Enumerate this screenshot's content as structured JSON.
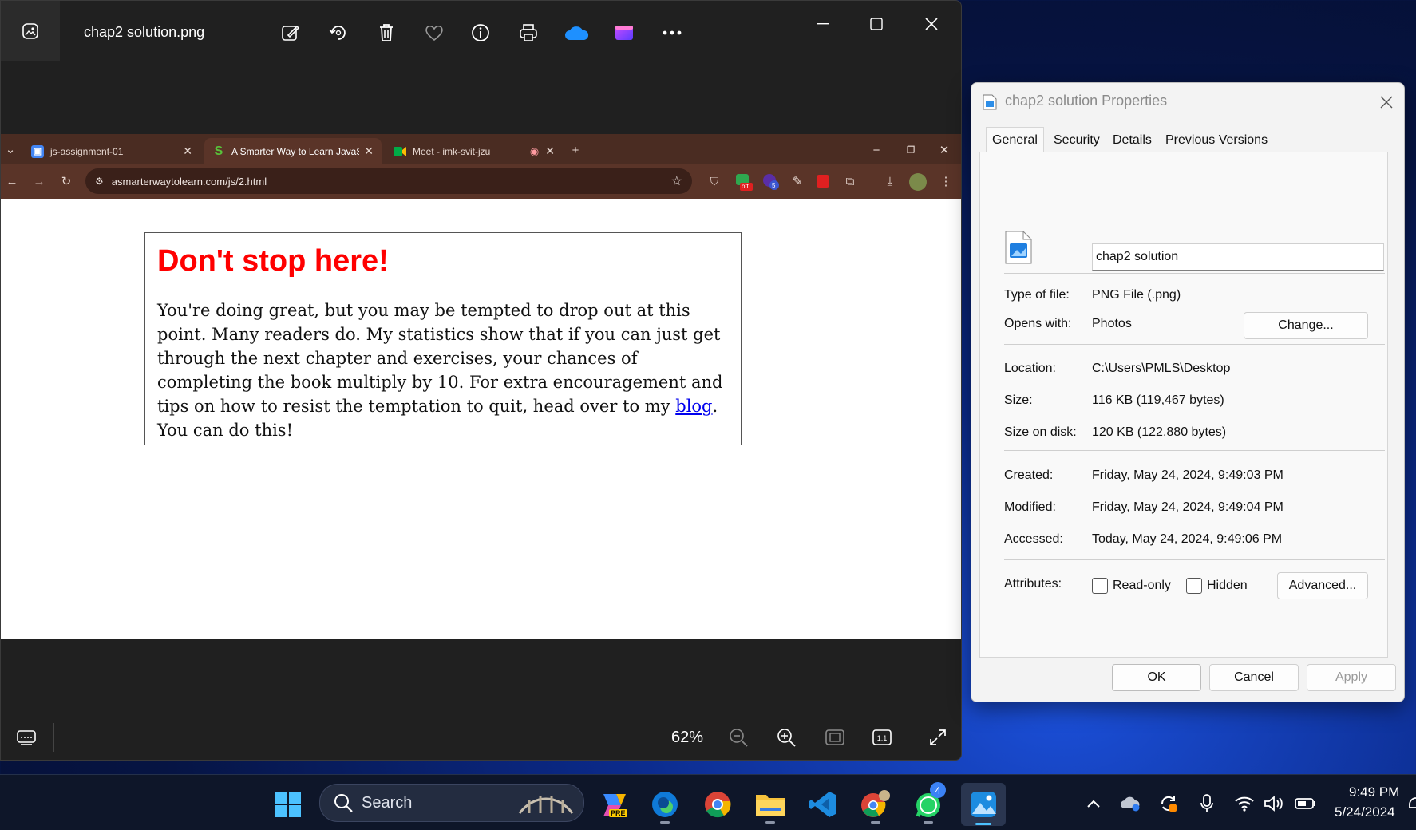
{
  "photos": {
    "title": "chap2 solution.png",
    "zoom": "62%",
    "toolbar_icons": [
      "edit-icon",
      "rotate-icon",
      "delete-icon",
      "favorite-icon",
      "info-icon",
      "print-icon",
      "onedrive-icon",
      "clipchamp-icon",
      "more-icon"
    ]
  },
  "browser": {
    "tabs": [
      {
        "label": "js-assignment-01"
      },
      {
        "label": "A Smarter Way to Learn JavaScr"
      },
      {
        "label": "Meet - imk-svit-jzu"
      }
    ],
    "url": "asmarterwaytolearn.com/js/2.html",
    "badge_off": "off",
    "badge_count": "5"
  },
  "page": {
    "heading": "Don't stop here!",
    "para_before": "You're doing great, but you may be tempted to drop out at this point. Many readers do. My statistics show that if you can just get through the next chapter and exercises, your chances of completing the book multiply by 10. For extra encouragement and tips on how to resist the temptation to quit, head over to my ",
    "link": "blog",
    "para_after": ". You can do this!"
  },
  "properties": {
    "title": "chap2 solution Properties",
    "tabs": [
      "General",
      "Security",
      "Details",
      "Previous Versions"
    ],
    "file_name": "chap2 solution",
    "rows": {
      "type_label": "Type of file:",
      "type_value": "PNG File (.png)",
      "opens_label": "Opens with:",
      "opens_value": "Photos",
      "location_label": "Location:",
      "location_value": "C:\\Users\\PMLS\\Desktop",
      "size_label": "Size:",
      "size_value": "116 KB (119,467 bytes)",
      "disk_label": "Size on disk:",
      "disk_value": "120 KB (122,880 bytes)",
      "created_label": "Created:",
      "created_value": "Friday, May 24, 2024, 9:49:03 PM",
      "modified_label": "Modified:",
      "modified_value": "Friday, May 24, 2024, 9:49:04 PM",
      "accessed_label": "Accessed:",
      "accessed_value": "Today, May 24, 2024, 9:49:06 PM",
      "attributes_label": "Attributes:"
    },
    "readonly_label": "Read-only",
    "hidden_label": "Hidden",
    "buttons": {
      "change": "Change...",
      "advanced": "Advanced...",
      "ok": "OK",
      "cancel": "Cancel",
      "apply": "Apply"
    }
  },
  "taskbar": {
    "search_label": "Search",
    "whatsapp_badge": "4",
    "copilot_badge": "PRE",
    "time": "9:49 PM",
    "date": "5/24/2024"
  }
}
